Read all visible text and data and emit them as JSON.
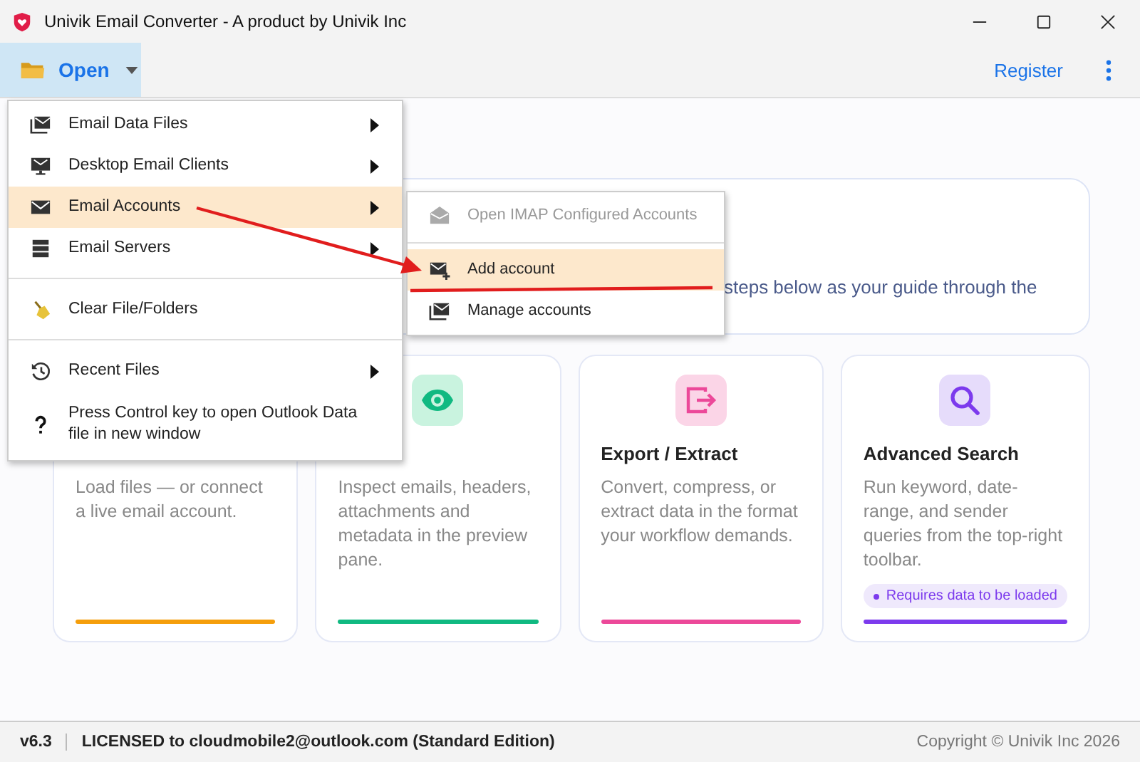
{
  "window": {
    "title": "Univik Email Converter - A product by Univik Inc"
  },
  "toolbar": {
    "open_button": "Open",
    "register_link": "Register"
  },
  "menu": {
    "items": [
      {
        "label": "Email Data Files",
        "has_submenu": true,
        "selected": false,
        "divider_before": false
      },
      {
        "label": "Desktop Email Clients",
        "has_submenu": true,
        "selected": false,
        "divider_before": false
      },
      {
        "label": "Email Accounts",
        "has_submenu": true,
        "selected": true,
        "divider_before": false
      },
      {
        "label": "Email Servers",
        "has_submenu": true,
        "selected": false,
        "divider_before": false
      },
      {
        "label": "Clear File/Folders",
        "has_submenu": false,
        "selected": false,
        "divider_before": true
      },
      {
        "label": "Recent Files",
        "has_submenu": true,
        "selected": false,
        "divider_before": true
      },
      {
        "label": "Press Control key to open Outlook Data file in new window",
        "has_submenu": false,
        "selected": false,
        "divider_before": false
      }
    ]
  },
  "submenu": {
    "items": [
      {
        "label": "Open IMAP Configured Accounts",
        "disabled": true,
        "selected": false,
        "divider_before": false
      },
      {
        "label": "Add account",
        "disabled": false,
        "selected": true,
        "divider_before": true
      },
      {
        "label": "Manage accounts",
        "disabled": false,
        "selected": false,
        "divider_before": false
      }
    ]
  },
  "welcome": {
    "text": "steps below as your guide through the"
  },
  "cards": [
    {
      "text": "Load files — or connect a live email account.",
      "color": "#f59e0b"
    },
    {
      "text": "Inspect emails, headers, attachments and metadata in the preview pane.",
      "color": "#10b981"
    },
    {
      "title": "Export / Extract",
      "text": "Convert, compress, or extract data in the format your workflow demands.",
      "color": "#ec4899"
    },
    {
      "title": "Advanced Search",
      "text": "Run keyword, date-range, and sender queries from the top-right toolbar.",
      "badge": "Requires data to be loaded",
      "color": "#7c3aed"
    }
  ],
  "status_bar": {
    "version": "v6.3",
    "license": "LICENSED to cloudmobile2@outlook.com (Standard Edition)",
    "copyright": "Copyright © Univik Inc 2026"
  }
}
